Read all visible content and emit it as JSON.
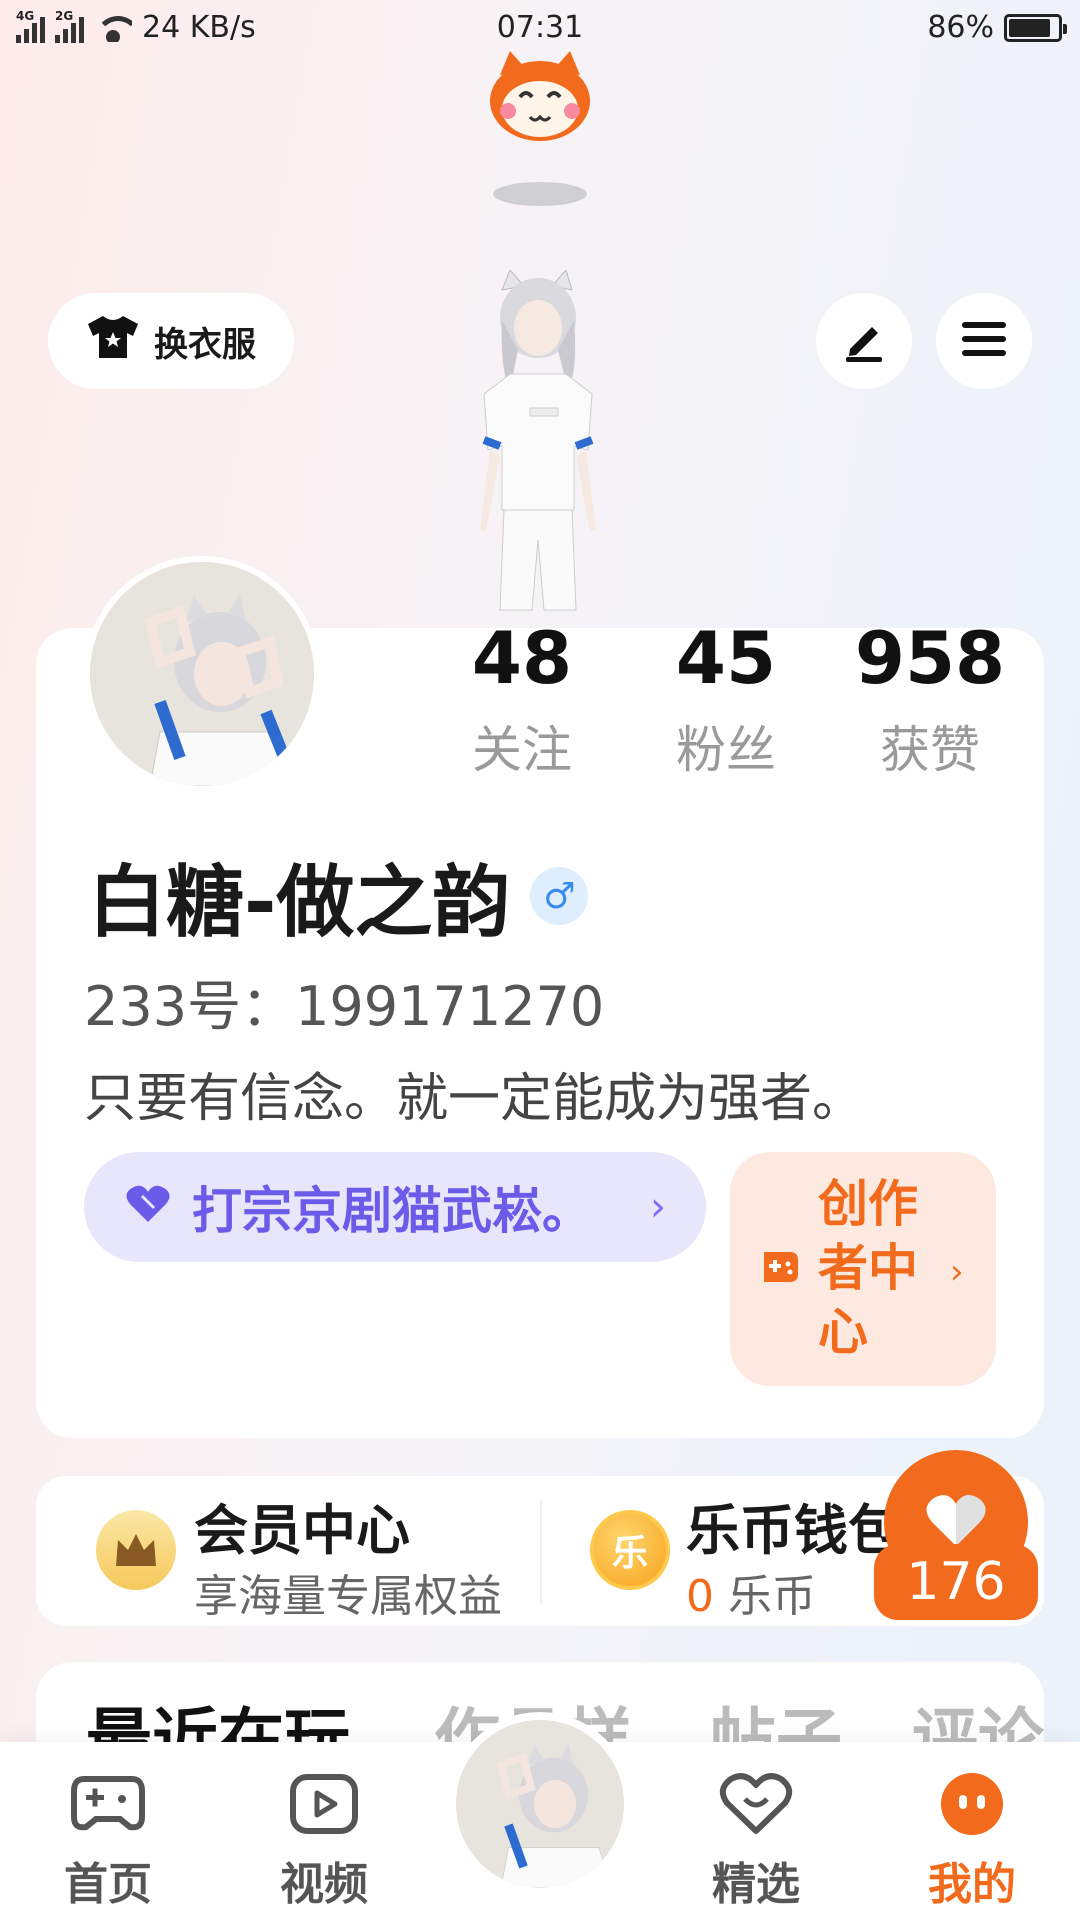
{
  "status_bar": {
    "net1": "4G",
    "net2": "2G",
    "speed": "24 KB/s",
    "time": "07:31",
    "battery": "86%",
    "battery_level": 0.86
  },
  "toolbar": {
    "outfit_label": "换衣服"
  },
  "profile": {
    "following_count": "48",
    "following_label": "关注",
    "fans_count": "45",
    "fans_label": "粉丝",
    "likes_count": "958",
    "likes_label": "获赞",
    "username": "白糖-做之韵",
    "gender_symbol": "♂",
    "uid": "233号：199171270",
    "bio": "只要有信念。就一定能成为强者。",
    "signature": "打宗京剧猫武崧。",
    "signature_arrow": "›",
    "creator_center": "创作者中心",
    "creator_arrow": "›"
  },
  "vip": {
    "title": "会员中心",
    "subtitle": "享海量专属权益"
  },
  "wallet": {
    "coin_glyph": "乐",
    "title": "乐币钱包",
    "amount": "0",
    "unit": "乐币"
  },
  "like_bubble": {
    "count": "176"
  },
  "tabs": [
    "最近在玩",
    "作品样",
    "帖子",
    "评论"
  ],
  "bottom_nav": {
    "home": "首页",
    "video": "视频",
    "featured": "精选",
    "mine": "我的"
  },
  "colors": {
    "accent": "#f26a1b",
    "purple": "#6a5be8",
    "gender_blue": "#3a8bf0"
  }
}
